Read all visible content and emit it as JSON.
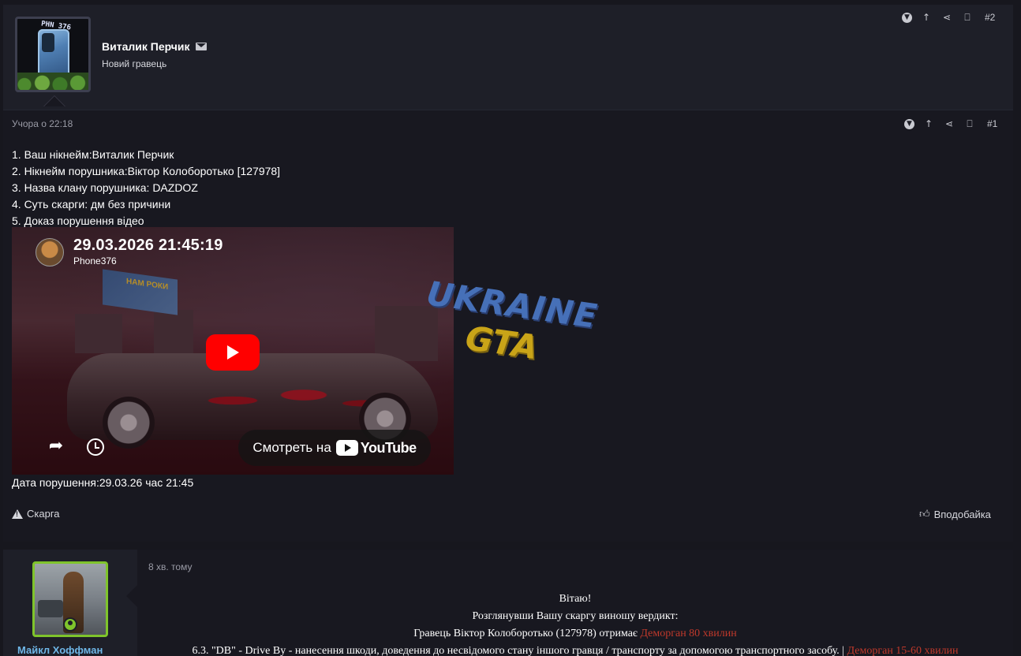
{
  "post1": {
    "username": "Виталик Перчик",
    "role": "Новий гравець",
    "avatar_text": "PHN 376",
    "date": "Учора о 22:18",
    "post_number": "#1",
    "lines": [
      "1. Ваш нікнейм:Виталик Перчик",
      "2. Нікнейм порушника:Віктор Колоборотько [127978]",
      "3. Назва клану порушника: DAZDOZ",
      "4. Суть скарги: дм без причини",
      "5. Доказ порушення відео"
    ],
    "video": {
      "title": "29.03.2026 21:45:19",
      "channel": "Phone376",
      "billboard": "НАМ РОКИ",
      "watch_label": "Смотреть на",
      "brand": "YouTube"
    },
    "date_line": "Дата порушення:29.03.26 час 21:45",
    "report_label": "Скарга",
    "like_label": "Вподобайка"
  },
  "watermark": {
    "line1": "UKRAINE",
    "line2": "GTA"
  },
  "post2": {
    "username": "Майкл Хоффман",
    "date": "8 хв. тому",
    "post_number": "#2",
    "greeting": "Вітаю!",
    "line2": "Розглянувши Вашу скаргу виношу вердикт:",
    "line3_text": "Гравець Віктор Колоборотько (127978) отримає ",
    "line3_penalty": "Деморган 80 хвилин",
    "line4_text": "6.3. \"DB\" - Drive By - нанесення шкоди, доведення до несвідомого стану іншого гравця / транспорту за допомогою транспортного засобу. | ",
    "line4_penalty": "Деморган 15-60 хвилин"
  },
  "colors": {
    "background": "#17171e",
    "panel": "#1e1f28",
    "body": "#181820",
    "accent_green": "#7fc42b",
    "username_blue": "#6fb7e8",
    "penalty_red": "#c0392b",
    "youtube_red": "#ff0000"
  },
  "icons": {
    "mail": "envelope-icon",
    "collapse": "chevron-circle-down-icon",
    "jump": "arrow-up-icon",
    "share": "share-icon",
    "bookmark": "bookmark-icon",
    "report": "warning-icon",
    "like": "thumbs-up-icon",
    "online": "online-user-icon"
  }
}
